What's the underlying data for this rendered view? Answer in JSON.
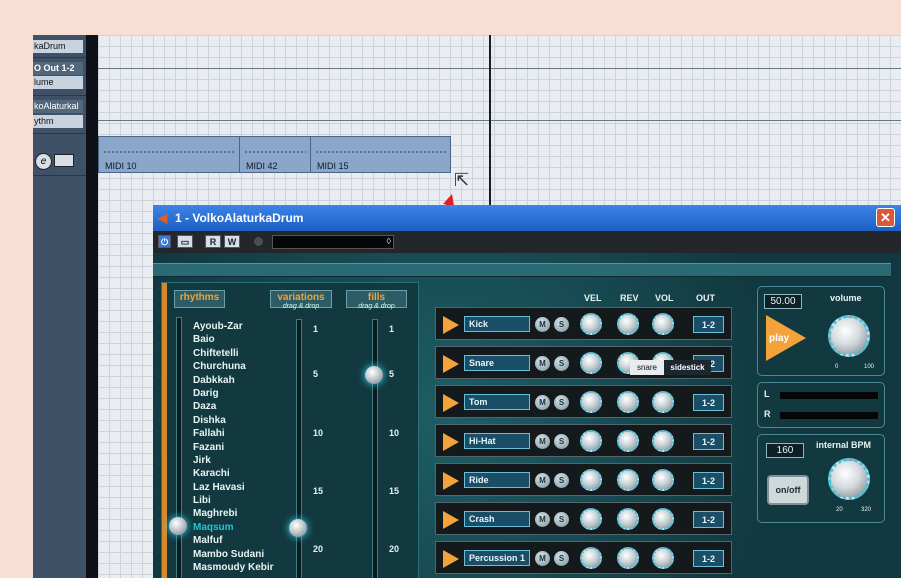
{
  "tracks": [
    {
      "name": "kaDrum"
    },
    {
      "name": "O Out 1-2"
    },
    {
      "name": "lume"
    },
    {
      "name": "koAlaturkal"
    },
    {
      "name": "ythm"
    }
  ],
  "midi_parts": [
    "MIDI 10",
    "MIDI 42",
    "MIDI 15"
  ],
  "plugin": {
    "title": "1 - VolkoAlaturkaDrum",
    "close_glyph": "✕",
    "toolbar": {
      "power": "⏻",
      "preset_btn": "▭",
      "read": "R",
      "write": "W",
      "preset_arrow": "◊"
    },
    "headers": {
      "rhythms": "rhythms",
      "variations": "variations",
      "variations_sub": "drag & drop",
      "fills": "fills",
      "fills_sub": "drag & drop"
    },
    "rhythms": [
      "Ayoub-Zar",
      "Baio",
      "Chiftetelli",
      "Churchuna",
      "Dabkkah",
      "Darig",
      "Daza",
      "Dishka",
      "Fallahi",
      "Fazani",
      "Jirk",
      "Karachi",
      "Laz Havasi",
      "Libi",
      "Maghrebi",
      "Maqsum",
      "Malfuf",
      "Mambo Sudani",
      "Masmoudy Kebir"
    ],
    "selected_rhythm": "Maqsum",
    "variation_ticks": [
      "1",
      "5",
      "10",
      "15",
      "20"
    ],
    "fill_ticks": [
      "1",
      "5",
      "10",
      "15",
      "20"
    ],
    "column_headers": {
      "vel": "VEL",
      "rev": "REV",
      "vol": "VOL",
      "out": "OUT"
    },
    "instruments": [
      {
        "name": "Kick",
        "mute": "M",
        "solo": "S",
        "out": "1-2"
      },
      {
        "name": "Snare",
        "mute": "M",
        "solo": "S",
        "out": "1-2"
      },
      {
        "name": "Tom",
        "mute": "M",
        "solo": "S",
        "out": "1-2"
      },
      {
        "name": "Hi-Hat",
        "mute": "M",
        "solo": "S",
        "out": "1-2"
      },
      {
        "name": "Ride",
        "mute": "M",
        "solo": "S",
        "out": "1-2"
      },
      {
        "name": "Crash",
        "mute": "M",
        "solo": "S",
        "out": "1-2"
      },
      {
        "name": "Percussion 1",
        "mute": "M",
        "solo": "S",
        "out": "1-2"
      }
    ],
    "volume": {
      "value": "50.00",
      "label": "volume",
      "min": "0",
      "max": "100"
    },
    "play_label": "play",
    "meters": {
      "left": "L",
      "right": "R"
    },
    "bpm": {
      "value": "160",
      "label": "internal BPM",
      "min": "20",
      "max": "320"
    },
    "onoff_label": "on/off",
    "snare_label": "snare",
    "sidestick_label": "sidestick"
  },
  "colors": {
    "accent": "#f3a33a",
    "titlebar": "#1c5fc4",
    "gui": "#1e5e66"
  }
}
